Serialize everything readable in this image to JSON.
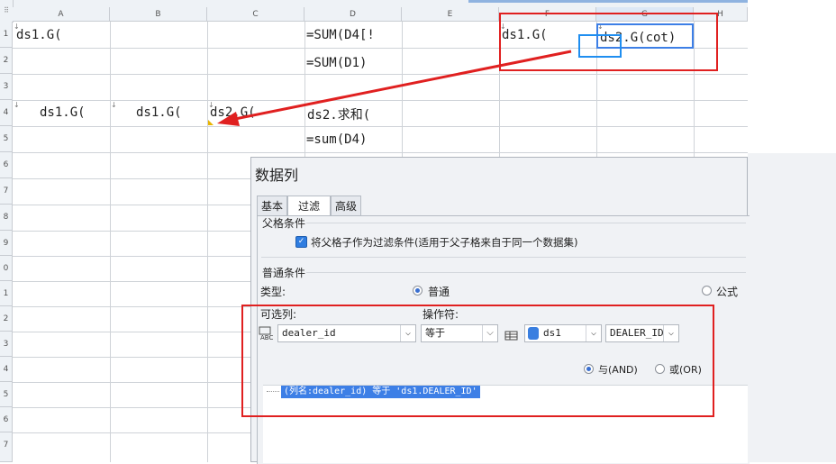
{
  "sheet": {
    "columns": [
      "A",
      "B",
      "C",
      "D",
      "E",
      "F",
      "G",
      "H"
    ],
    "rows": [
      "1",
      "2",
      "3",
      "4",
      "5",
      "6",
      "7",
      "8",
      "9",
      "0",
      "1",
      "2",
      "3",
      "4",
      "5",
      "6",
      "7"
    ],
    "cells": {
      "a1": "ds1.G(",
      "d1": "=SUM(D4[!",
      "f1": "ds1.G(",
      "g1": "ds2.G(cot)",
      "d2": "=SUM(D1)",
      "a4": "ds1.G(",
      "b4": "ds1.G(",
      "c4": "ds2.G(",
      "d4": "ds2.求和(",
      "d5": "=sum(D4)"
    }
  },
  "dialog": {
    "title": "数据列",
    "tabs": [
      "基本",
      "过滤",
      "高级"
    ],
    "active_tab": "过滤",
    "parent_section": "父格条件",
    "parent_checkbox_label": "将父格子作为过滤条件(适用于父子格来自于同一个数据集)",
    "normal_section": "普通条件",
    "type_label": "类型:",
    "type_normal": "普通",
    "type_formula": "公式",
    "column_label": "可选列:",
    "operator_label": "操作符:",
    "column_value": "dealer_id",
    "operator_value": "等于",
    "dataset_value": "ds1",
    "field_value": "DEALER_ID",
    "and_label": "与(AND)",
    "or_label": "或(OR)",
    "condition_item": "(列名:dealer_id) 等于 'ds1.DEALER_ID'"
  },
  "colors": {
    "annotation_red": "#e02020",
    "annotation_blue": "#1f8ef0",
    "selection_blue": "#3d7fe6"
  }
}
